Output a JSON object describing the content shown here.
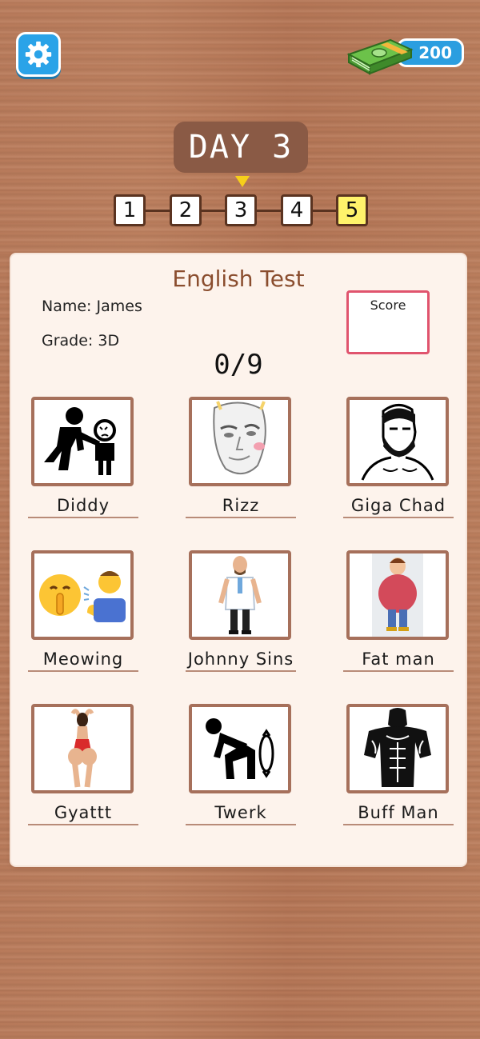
{
  "header": {
    "settings_icon": "gear-icon",
    "cash_icon": "cash-stack-icon",
    "cash_amount": "200"
  },
  "day": {
    "title": "DAY 3",
    "steps": [
      "1",
      "2",
      "3",
      "4",
      "5"
    ],
    "current_step": "3",
    "highlight_step": "5"
  },
  "test": {
    "title": "English Test",
    "name_line": "Name: James",
    "grade_line": "Grade: 3D",
    "score_label": "Score",
    "progress": "0/9"
  },
  "cards": [
    {
      "label": "Diddy",
      "icon": "adult-child-silhouette-icon"
    },
    {
      "label": "Rizz",
      "icon": "rizz-face-icon"
    },
    {
      "label": "Giga Chad",
      "icon": "giga-chad-icon"
    },
    {
      "label": "Meowing",
      "icon": "shush-emoji-icon"
    },
    {
      "label": "Johnny Sins",
      "icon": "doctor-icon"
    },
    {
      "label": "Fat man",
      "icon": "fat-man-icon"
    },
    {
      "label": "Gyattt",
      "icon": "swimsuit-woman-icon"
    },
    {
      "label": "Twerk",
      "icon": "twerk-figure-icon"
    },
    {
      "label": "Buff Man",
      "icon": "buff-man-icon"
    }
  ],
  "colors": {
    "accent_blue": "#2aa3e8",
    "score_border": "#e0546e",
    "highlight_yellow": "#fff36b",
    "card_border": "#a6705b"
  }
}
